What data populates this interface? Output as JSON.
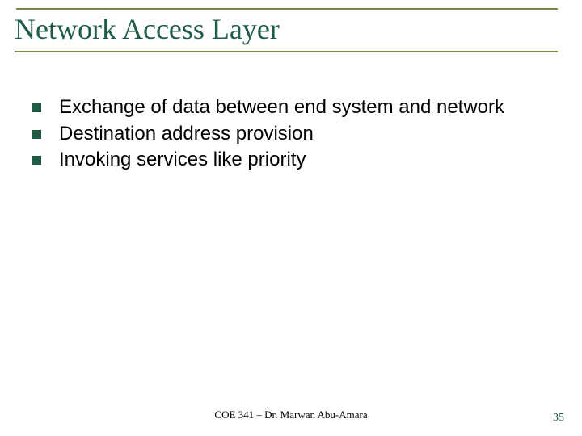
{
  "title": "Network Access Layer",
  "bullets": [
    "Exchange of data between end system and network",
    "Destination address provision",
    "Invoking services like priority"
  ],
  "footer": {
    "center": "COE 341 – Dr. Marwan Abu-Amara",
    "page": "35"
  }
}
